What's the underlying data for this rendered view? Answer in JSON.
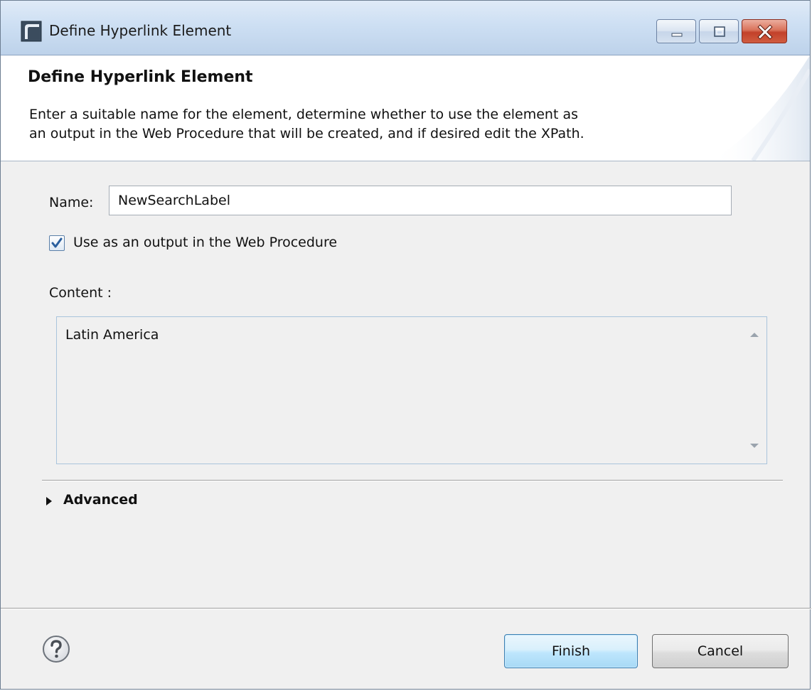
{
  "window": {
    "title": "Define Hyperlink Element"
  },
  "banner": {
    "title": "Define Hyperlink Element",
    "description_line1": "Enter a suitable name for the element, determine whether to use the element as",
    "description_line2": "an output in the Web Procedure that will be created, and if desired edit the XPath."
  },
  "form": {
    "name_label": "Name:",
    "name_value": "NewSearchLabel",
    "use_as_output_label": "Use as an output in the Web Procedure",
    "use_as_output_checked": true,
    "content_label": "Content :",
    "content_value": "Latin America",
    "advanced_label": "Advanced",
    "advanced_expanded": false
  },
  "footer": {
    "help_icon": "question-mark-icon",
    "finish_label": "Finish",
    "cancel_label": "Cancel"
  },
  "colors": {
    "close_button": "#c2412a",
    "finish_border": "#3c7fb1",
    "checkbox_check": "#2a5f9e"
  }
}
